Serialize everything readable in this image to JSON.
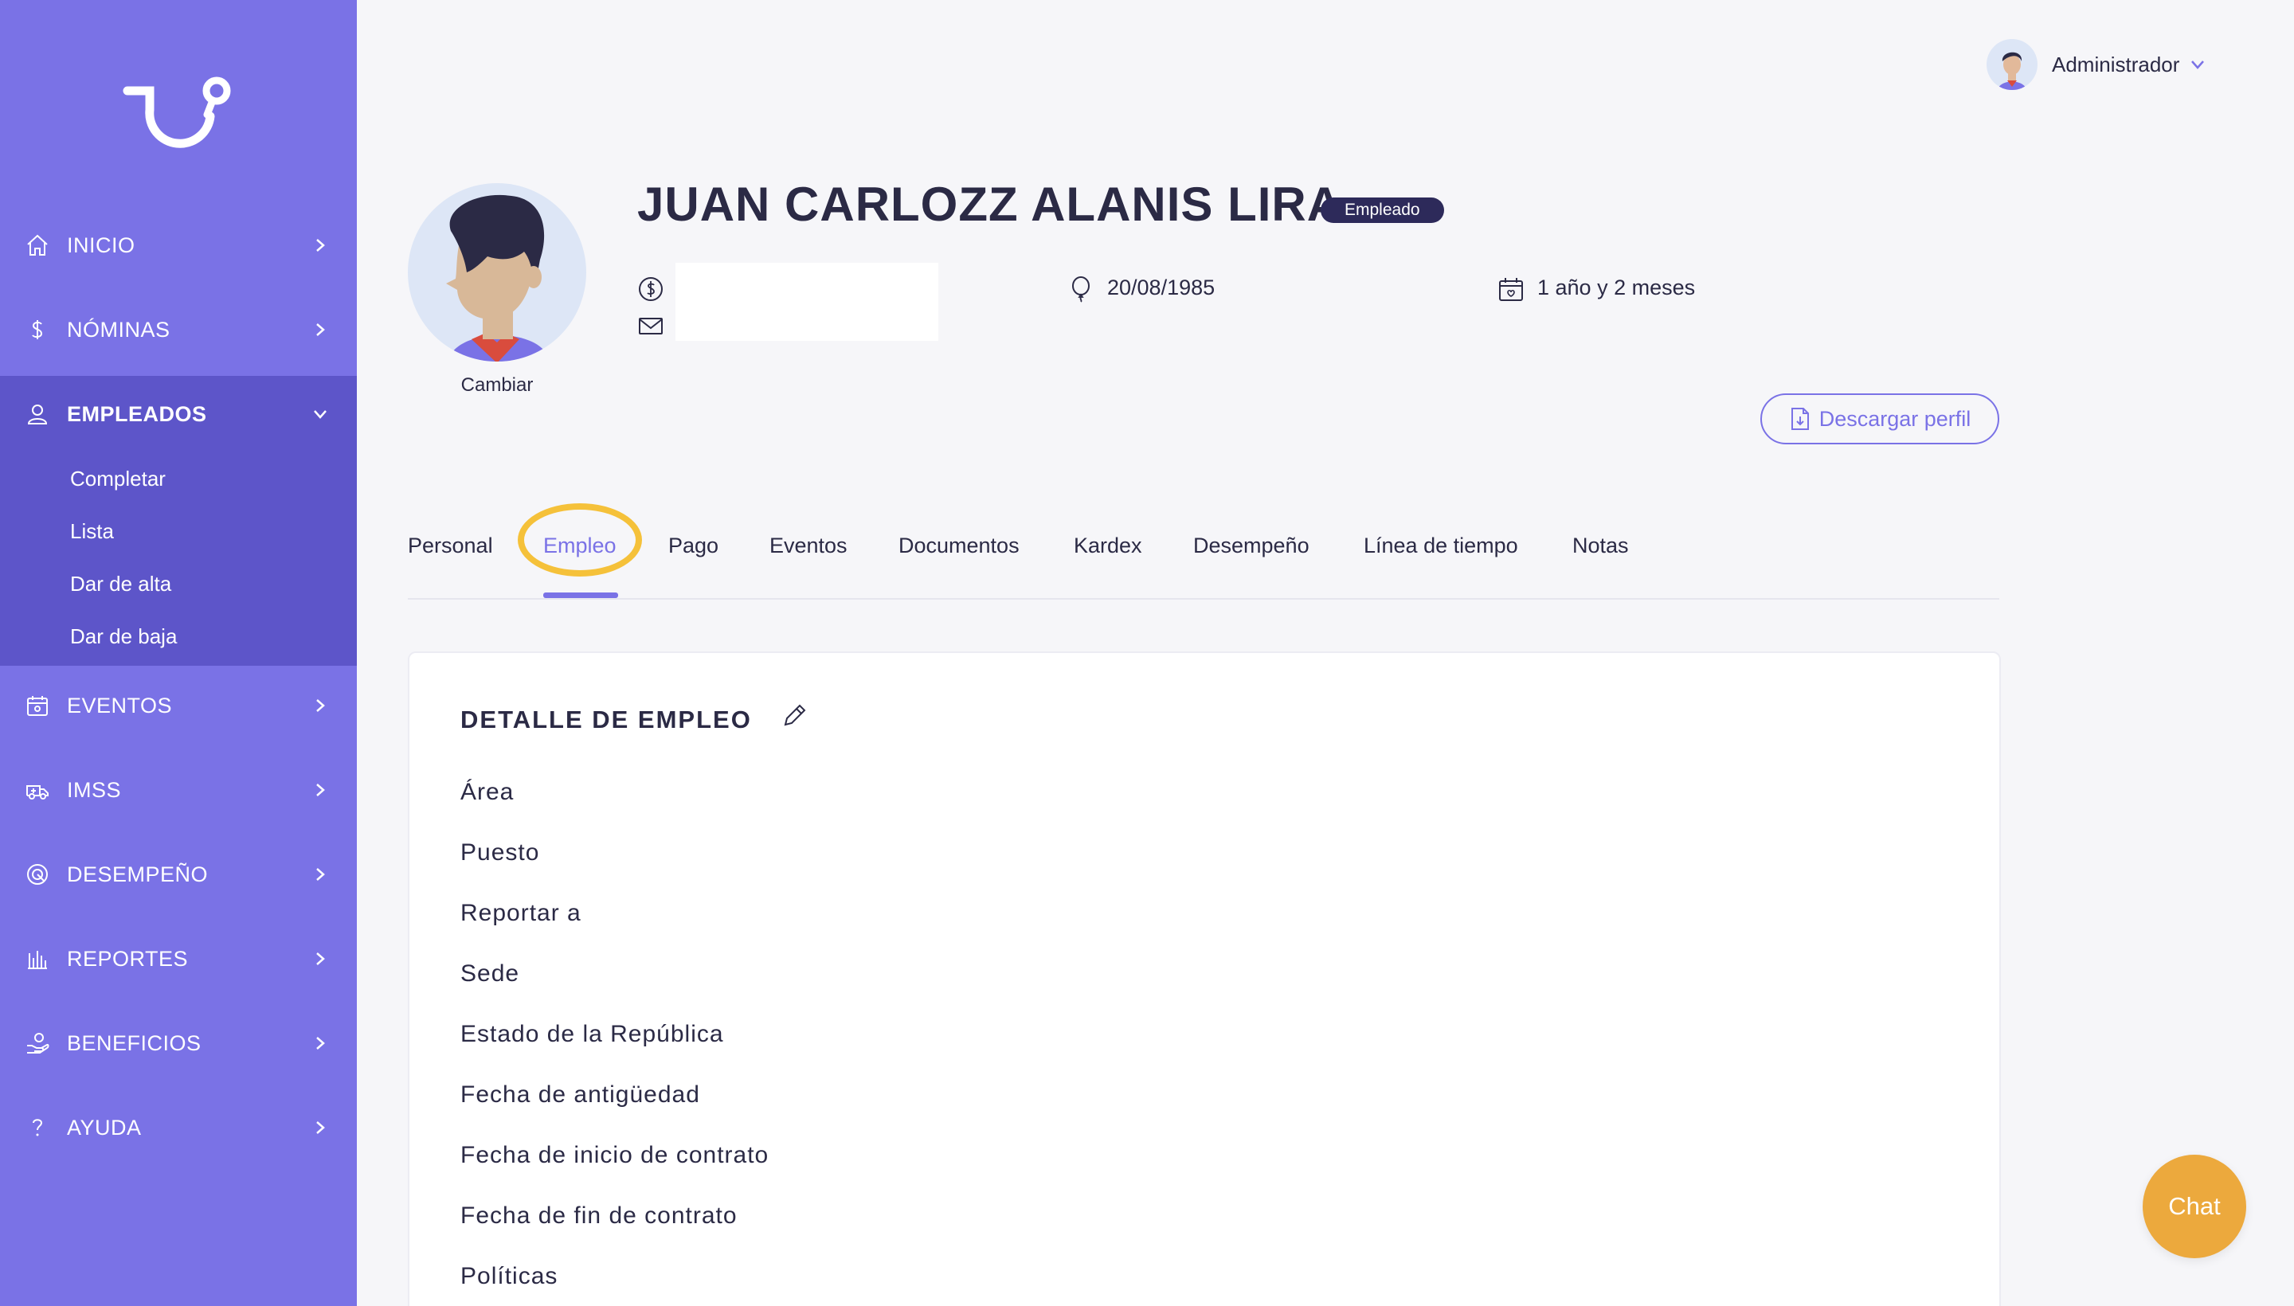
{
  "sidebar": {
    "items": [
      {
        "label": "INICIO",
        "icon": "home-icon"
      },
      {
        "label": "NÓMINAS",
        "icon": "dollar-icon"
      },
      {
        "label": "EMPLEADOS",
        "icon": "user-icon"
      },
      {
        "label": "EVENTOS",
        "icon": "calendar-icon"
      },
      {
        "label": "IMSS",
        "icon": "ambulance-icon"
      },
      {
        "label": "DESEMPEÑO",
        "icon": "target-icon"
      },
      {
        "label": "REPORTES",
        "icon": "bar-chart-icon"
      },
      {
        "label": "BENEFICIOS",
        "icon": "gift-hand-icon"
      },
      {
        "label": "AYUDA",
        "icon": "question-icon"
      }
    ],
    "sub_items": [
      "Completar",
      "Lista",
      "Dar de alta",
      "Dar de baja"
    ]
  },
  "user_menu": {
    "name": "Administrador"
  },
  "profile": {
    "name": "JUAN CARLOZZ ALANIS LIRA",
    "badge": "Empleado",
    "change_photo": "Cambiar",
    "birth_date": "20/08/1985",
    "seniority": "1 año y 2 meses",
    "download_label": "Descargar perfil"
  },
  "tabs": [
    "Personal",
    "Empleo",
    "Pago",
    "Eventos",
    "Documentos",
    "Kardex",
    "Desempeño",
    "Línea de tiempo",
    "Notas"
  ],
  "active_tab": "Empleo",
  "card": {
    "title": "DETALLE DE EMPLEO",
    "fields": [
      "Área",
      "Puesto",
      "Reportar a",
      "Sede",
      "Estado de la República",
      "Fecha de antigüedad",
      "Fecha de inicio de contrato",
      "Fecha de fin de contrato",
      "Políticas"
    ]
  },
  "chat": {
    "label": "Chat"
  },
  "colors": {
    "sidebar": "#7a72e6",
    "sidebar_active": "#5d55c9",
    "accent": "#7a72e6",
    "badge": "#2d2a5a",
    "highlight": "#f5c13a",
    "chat": "#eca93d"
  }
}
